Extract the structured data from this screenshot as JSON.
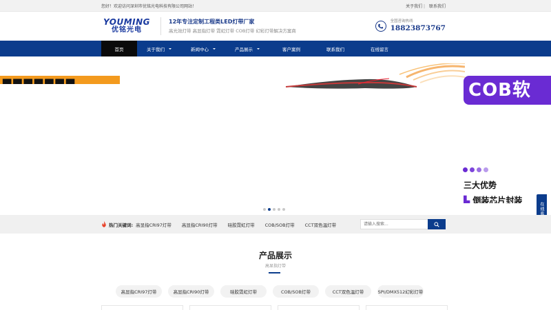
{
  "topbar": {
    "welcome": "您好！欢迎访问深圳市优铭光电科技有限公司网站！",
    "about_link": "关于我们",
    "separator": "|",
    "contact_link": "联系我们"
  },
  "header": {
    "logo_en": "YOUMING",
    "logo_cn": "优铭光电",
    "slogan_title": "12年专注定制工程类LED灯带厂家",
    "slogan_sub": "高光效灯带 高显指灯带 霓虹灯带 COB灯带 幻彩灯带解决方案商",
    "hotline_label": "全国咨询热线",
    "hotline_number": "18823873767"
  },
  "nav": {
    "items": [
      {
        "label": "首页"
      },
      {
        "label": "关于我们"
      },
      {
        "label": "新闻中心"
      },
      {
        "label": "产品展示"
      },
      {
        "label": "客户案例"
      },
      {
        "label": "联系我们"
      },
      {
        "label": "在线留言"
      }
    ]
  },
  "banner": {
    "purple_text": "COB软",
    "advantage_text": "三大优势",
    "flip_text": "倒装芯片封装",
    "side_chat": "在线客服",
    "slide_count": 5,
    "active_slide": 2
  },
  "keywords": {
    "label": "热门关键词:",
    "items": [
      "高显指CRI97灯带",
      "高显指CRI90灯带",
      "硅胶霓虹灯带",
      "COB/SOB灯带",
      "CCT双色温灯带"
    ],
    "search_placeholder": "请输入搜索..."
  },
  "products": {
    "title": "产品展示",
    "subtitle": "高显指灯带",
    "tabs": [
      "高显指CRI97灯带",
      "高显指CRI90灯带",
      "硅胶霓虹灯带",
      "COB/SOB灯带",
      "CCT双色温灯带",
      "SPI/DMX512幻彩灯带"
    ]
  },
  "colors": {
    "brand_blue": "#0b3c8c",
    "accent_orange": "#f39a1e",
    "accent_purple": "#6a2bd3"
  }
}
